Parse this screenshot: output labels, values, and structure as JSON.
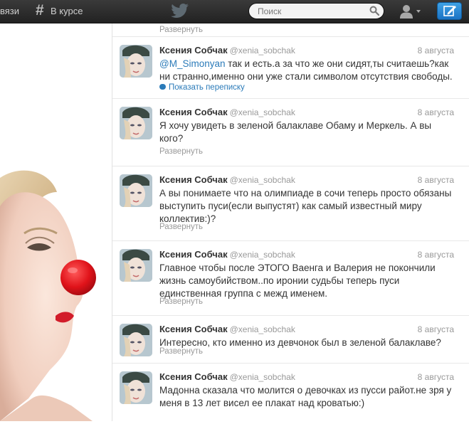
{
  "topbar": {
    "connect_label": "вязи",
    "discover_label": "В курсе",
    "search_placeholder": "Поиск"
  },
  "tweets": [
    {
      "action": "Развернуть"
    },
    {
      "name": "Ксения Собчак",
      "handle": "@xenia_sobchak",
      "time": "8 августа",
      "mention": "@M_Simonyan",
      "text": " так и есть.а за что же они сидят,ты считаешь?как ни странно,именно они уже стали символом отсутствия свободы.",
      "action": "Показать переписку"
    },
    {
      "name": "Ксения Собчак",
      "handle": "@xenia_sobchak",
      "time": "8 августа",
      "text": "Я хочу увидеть в зеленой балаклаве Обаму и Меркель. А вы кого?",
      "action": "Развернуть"
    },
    {
      "name": "Ксения Собчак",
      "handle": "@xenia_sobchak",
      "time": "8 августа",
      "text": "А вы понимаете что на олимпиаде в сочи теперь просто обязаны выступить пуси(если выпустят) как самый известный миру коллектив:)?",
      "action": "Развернуть"
    },
    {
      "name": "Ксения Собчак",
      "handle": "@xenia_sobchak",
      "time": "8 августа",
      "text": "Главное чтобы после ЭТОГО Ваенга и Валерия не покончили жизнь самоубийством..по иронии судьбы теперь пуси единственная группа с межд именем.",
      "action": "Развернуть"
    },
    {
      "name": "Ксения Собчак",
      "handle": "@xenia_sobchak",
      "time": "8 августа",
      "text": "Интересно, кто именно из девчонок был в зеленой балаклаве?",
      "action": "Развернуть"
    },
    {
      "name": "Ксения Собчак",
      "handle": "@xenia_sobchak",
      "time": "8 августа",
      "text": "Мадонна сказала что молится о девочках из пусси райот.не зря у меня в 13 лет висел ее плакат над кроватью:)"
    }
  ]
}
